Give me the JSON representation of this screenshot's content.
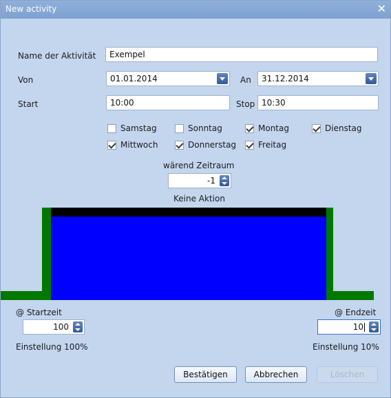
{
  "window": {
    "title": "New activity",
    "close_glyph": "✕"
  },
  "form": {
    "name_label": "Name der Aktivität",
    "name_value": "Exempel",
    "from_label": "Von",
    "from_value": "01.01.2014",
    "to_label": "An",
    "to_value": "31.12.2014",
    "start_label": "Start",
    "start_value": "10:00",
    "stop_label": "Stop",
    "stop_value": "10:30"
  },
  "days": [
    {
      "label": "Samstag",
      "checked": false
    },
    {
      "label": "Sonntag",
      "checked": false
    },
    {
      "label": "Montag",
      "checked": true
    },
    {
      "label": "Dienstag",
      "checked": true
    },
    {
      "label": "Mittwoch",
      "checked": true
    },
    {
      "label": "Donnerstag",
      "checked": true
    },
    {
      "label": "Freitag",
      "checked": true
    }
  ],
  "period": {
    "label": "wärend Zeitraum",
    "value": "-1",
    "status": "Keine Aktion"
  },
  "diagram": {
    "fill_color": "#0000ff",
    "edge_color": "#007800",
    "top_color": "#000000"
  },
  "start_setting": {
    "label": "@ Startzeit",
    "value": "100",
    "caption": "Einstellung 100%"
  },
  "end_setting": {
    "label": "@ Endzeit",
    "value": "10",
    "caption": "Einstellung 10%"
  },
  "buttons": {
    "confirm": "Bestätigen",
    "cancel": "Abbrechen",
    "delete": "Löschen"
  }
}
